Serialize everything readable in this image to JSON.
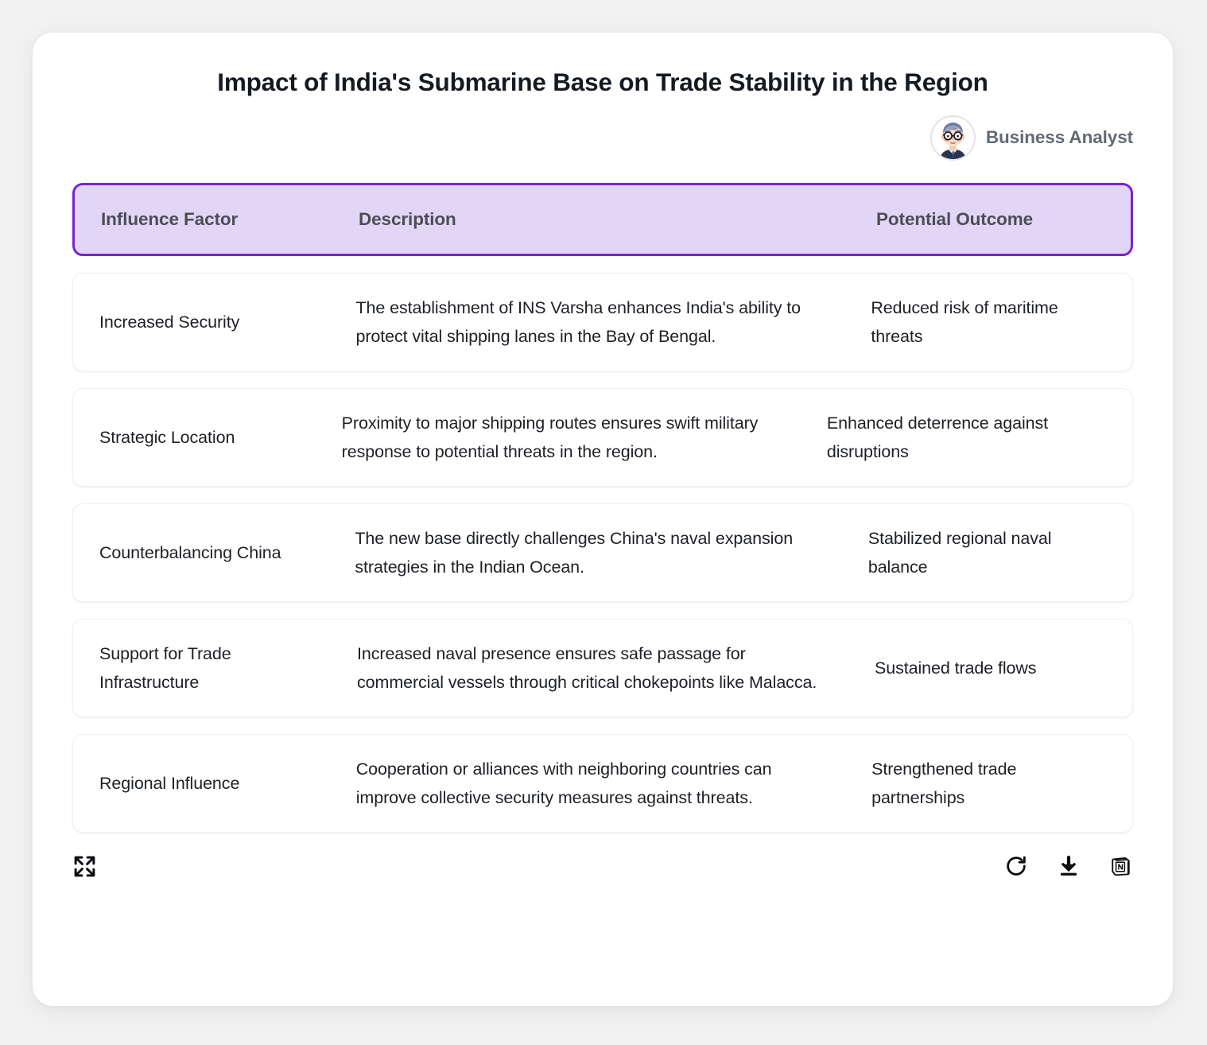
{
  "header": {
    "title": "Impact of India's Submarine Base on Trade Stability in the Region",
    "persona_label": "Business Analyst",
    "avatar_icon": "business-analyst-avatar"
  },
  "theme": {
    "header_fill": "#e2d6f7",
    "header_border": "#7a22d0",
    "header_text": "#4b4e55",
    "body_text": "#1d2025",
    "page_bg": "#f1f1f2",
    "card_bg": "#ffffff"
  },
  "table": {
    "columns": [
      {
        "key": "factor",
        "label": "Influence Factor"
      },
      {
        "key": "desc",
        "label": "Description"
      },
      {
        "key": "outcome",
        "label": "Potential Outcome"
      }
    ],
    "rows": [
      {
        "factor": "Increased Security",
        "desc": "The establishment of INS Varsha enhances India's ability to protect vital shipping lanes in the Bay of Bengal.",
        "outcome": "Reduced risk of maritime threats"
      },
      {
        "factor": "Strategic Location",
        "desc": "Proximity to major shipping routes ensures swift military response to potential threats in the region.",
        "outcome": "Enhanced deterrence against disruptions"
      },
      {
        "factor": "Counterbalancing China",
        "desc": "The new base directly challenges China's naval expansion strategies in the Indian Ocean.",
        "outcome": "Stabilized regional naval balance"
      },
      {
        "factor": "Support for Trade Infrastructure",
        "desc": "Increased naval presence ensures safe passage for commercial vessels through critical chokepoints like Malacca.",
        "outcome": "Sustained trade flows"
      },
      {
        "factor": "Regional Influence",
        "desc": "Cooperation or alliances with neighboring countries can improve collective security measures against threats.",
        "outcome": "Strengthened trade partnerships"
      }
    ]
  },
  "footer": {
    "expand_icon": "fullscreen-expand-icon",
    "refresh_icon": "refresh-icon",
    "download_icon": "download-icon",
    "notion_icon": "notion-logo-icon"
  }
}
